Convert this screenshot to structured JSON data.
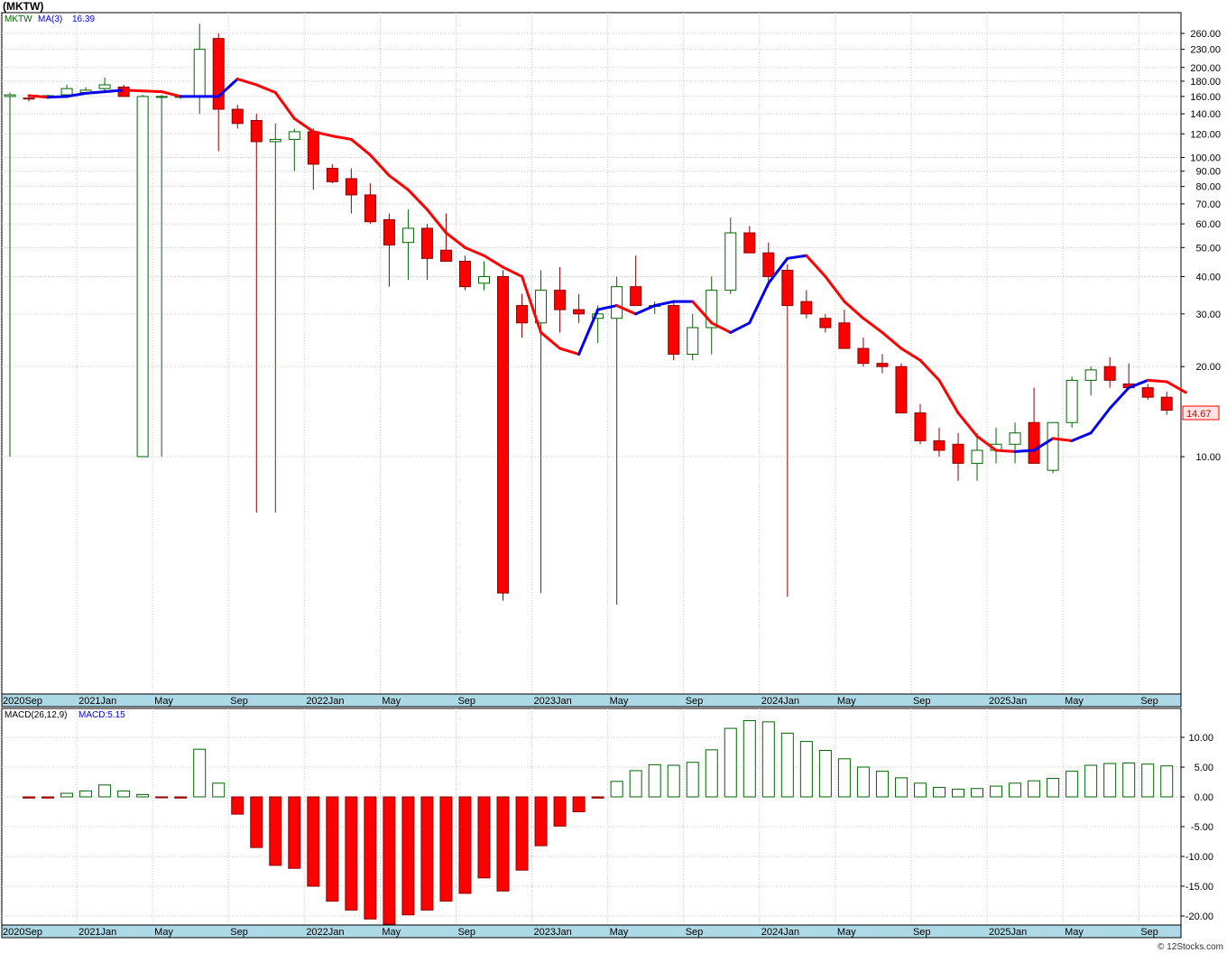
{
  "title": "(MKTW)",
  "footer": "© 12Stocks.com",
  "colors": {
    "up": "#006400",
    "down": "#ff0000",
    "ma_up": "#0000ee",
    "ma_down": "#ff0000",
    "macd_pos": "#006400",
    "macd_neg": "#ff0000",
    "axis_band": "#add8e6",
    "grid": "#c8c8c8"
  },
  "chart_data": [
    {
      "type": "candlestick",
      "scale": "log",
      "legend": {
        "ticker": "MKTW",
        "ma_label": "MA(3)",
        "ma_value": "16.39"
      },
      "last_price_label": "14.67",
      "y_ticks": [
        "260.00",
        "230.00",
        "200.00",
        "180.00",
        "160.00",
        "140.00",
        "120.00",
        "100.00",
        "90.00",
        "80.00",
        "70.00",
        "60.00",
        "50.00",
        "40.00",
        "30.00",
        "20.00",
        "10.00"
      ],
      "x_labels": [
        "2020Sep",
        "2021Jan",
        "May",
        "Sep",
        "2022Jan",
        "May",
        "Sep",
        "2023Jan",
        "May",
        "Sep",
        "2024Jan",
        "May",
        "Sep",
        "2025Jan",
        "May",
        "Sep"
      ],
      "grid": true,
      "candles": [
        {
          "o": 160,
          "h": 165,
          "l": 10,
          "c": 162
        },
        {
          "o": 158,
          "h": 160,
          "l": 154,
          "c": 157
        },
        {
          "o": 160,
          "h": 162,
          "l": 157,
          "c": 161
        },
        {
          "o": 162,
          "h": 175,
          "l": 158,
          "c": 170
        },
        {
          "o": 165,
          "h": 172,
          "l": 162,
          "c": 168
        },
        {
          "o": 170,
          "h": 185,
          "l": 165,
          "c": 175
        },
        {
          "o": 172,
          "h": 175,
          "l": 160,
          "c": 160
        },
        {
          "o": 10,
          "h": 162,
          "l": 10,
          "c": 160
        },
        {
          "o": 160,
          "h": 162,
          "l": 10,
          "c": 160
        },
        {
          "o": 160,
          "h": 162,
          "l": 157,
          "c": 160
        },
        {
          "o": 160,
          "h": 280,
          "l": 140,
          "c": 230
        },
        {
          "o": 250,
          "h": 260,
          "l": 105,
          "c": 145
        },
        {
          "o": 145,
          "h": 150,
          "l": 125,
          "c": 130
        },
        {
          "o": 133,
          "h": 140,
          "l": 6.5,
          "c": 113
        },
        {
          "o": 113,
          "h": 130,
          "l": 6.5,
          "c": 115
        },
        {
          "o": 115,
          "h": 125,
          "l": 90,
          "c": 122
        },
        {
          "o": 122,
          "h": 125,
          "l": 78,
          "c": 95
        },
        {
          "o": 92,
          "h": 95,
          "l": 82,
          "c": 83
        },
        {
          "o": 85,
          "h": 92,
          "l": 65,
          "c": 75
        },
        {
          "o": 75,
          "h": 82,
          "l": 60,
          "c": 61
        },
        {
          "o": 62,
          "h": 65,
          "l": 37,
          "c": 51
        },
        {
          "o": 52,
          "h": 67,
          "l": 39,
          "c": 58
        },
        {
          "o": 58,
          "h": 60,
          "l": 39,
          "c": 46
        },
        {
          "o": 49,
          "h": 65,
          "l": 45,
          "c": 45
        },
        {
          "o": 45,
          "h": 47,
          "l": 36,
          "c": 37
        },
        {
          "o": 38,
          "h": 45,
          "l": 36,
          "c": 40
        },
        {
          "o": 40,
          "h": 42,
          "l": 3.3,
          "c": 3.5
        },
        {
          "o": 32,
          "h": 35,
          "l": 25,
          "c": 28
        },
        {
          "o": 28,
          "h": 42,
          "l": 3.5,
          "c": 36
        },
        {
          "o": 36,
          "h": 43,
          "l": 26,
          "c": 31
        },
        {
          "o": 31,
          "h": 35,
          "l": 28,
          "c": 30
        },
        {
          "o": 29,
          "h": 32,
          "l": 24,
          "c": 30
        },
        {
          "o": 29,
          "h": 40,
          "l": 3.2,
          "c": 37
        },
        {
          "o": 37,
          "h": 47,
          "l": 32,
          "c": 32
        },
        {
          "o": 32,
          "h": 33,
          "l": 30,
          "c": 32
        },
        {
          "o": 32,
          "h": 33,
          "l": 21,
          "c": 22
        },
        {
          "o": 22,
          "h": 30,
          "l": 21,
          "c": 27
        },
        {
          "o": 27,
          "h": 40,
          "l": 22,
          "c": 36
        },
        {
          "o": 36,
          "h": 63,
          "l": 35,
          "c": 56
        },
        {
          "o": 56,
          "h": 59,
          "l": 50,
          "c": 48
        },
        {
          "o": 48,
          "h": 52,
          "l": 37,
          "c": 40
        },
        {
          "o": 42,
          "h": 44,
          "l": 3.4,
          "c": 32
        },
        {
          "o": 33,
          "h": 36,
          "l": 29,
          "c": 30
        },
        {
          "o": 29,
          "h": 30,
          "l": 26,
          "c": 27
        },
        {
          "o": 28,
          "h": 31,
          "l": 23,
          "c": 23
        },
        {
          "o": 23,
          "h": 25,
          "l": 20,
          "c": 20.5
        },
        {
          "o": 20.5,
          "h": 22,
          "l": 19,
          "c": 20
        },
        {
          "o": 20,
          "h": 20.5,
          "l": 14,
          "c": 14
        },
        {
          "o": 14,
          "h": 15,
          "l": 11,
          "c": 11.3
        },
        {
          "o": 11.3,
          "h": 12.5,
          "l": 10,
          "c": 10.5
        },
        {
          "o": 11,
          "h": 12,
          "l": 8.3,
          "c": 9.5
        },
        {
          "o": 9.5,
          "h": 12,
          "l": 8.3,
          "c": 10.5
        },
        {
          "o": 10.5,
          "h": 12.5,
          "l": 9.5,
          "c": 11
        },
        {
          "o": 11,
          "h": 13,
          "l": 9.5,
          "c": 12
        },
        {
          "o": 13,
          "h": 17,
          "l": 9.5,
          "c": 9.5
        },
        {
          "o": 9,
          "h": 13,
          "l": 8.8,
          "c": 13
        },
        {
          "o": 13,
          "h": 18.5,
          "l": 12.5,
          "c": 18
        },
        {
          "o": 18,
          "h": 20,
          "l": 16,
          "c": 19.5
        },
        {
          "o": 20,
          "h": 21.5,
          "l": 17,
          "c": 18
        },
        {
          "o": 17.5,
          "h": 20.5,
          "l": 17,
          "c": 17
        },
        {
          "o": 17,
          "h": 17.5,
          "l": 15.5,
          "c": 15.8
        },
        {
          "o": 15.8,
          "h": 16.5,
          "l": 13.8,
          "c": 14.3
        }
      ],
      "ma": [
        161,
        159,
        160,
        164,
        166,
        168,
        167,
        166,
        160,
        160,
        160,
        183,
        175,
        165,
        135,
        122,
        118,
        115,
        102,
        87,
        78,
        67,
        56,
        50,
        47,
        43,
        40,
        26,
        23,
        22,
        31,
        32,
        30,
        32,
        33,
        33,
        28,
        26,
        28,
        38,
        46,
        47,
        40,
        33,
        29,
        26,
        23,
        21,
        18,
        14,
        11.7,
        10.5,
        10.4,
        10.5,
        11.5,
        11.3,
        12,
        14.5,
        17,
        18,
        17.8,
        16.4
      ]
    },
    {
      "type": "bar",
      "legend": {
        "label": "MACD(26,12,9)",
        "value_label": "MACD:5.15"
      },
      "y_ticks": [
        "10.00",
        "5.00",
        "0.00",
        "-5.00",
        "-10.00",
        "-15.00",
        "-20.00"
      ],
      "ylim": [
        -21.5,
        13
      ],
      "x_labels": [
        "2020Sep",
        "2021Jan",
        "May",
        "Sep",
        "2022Jan",
        "May",
        "Sep",
        "2023Jan",
        "May",
        "Sep",
        "2024Jan",
        "May",
        "Sep",
        "2025Jan",
        "May",
        "Sep"
      ],
      "values": [
        -0.2,
        -0.2,
        0.6,
        1.0,
        2.0,
        1.0,
        0.4,
        -0.1,
        -0.2,
        8.0,
        2.3,
        -2.9,
        -8.5,
        -11.5,
        -12.0,
        -15.0,
        -17.5,
        -19.0,
        -20.5,
        -21.5,
        -19.8,
        -19.0,
        -17.5,
        -16.2,
        -13.6,
        -15.8,
        -12.3,
        -8.2,
        -4.9,
        -2.5,
        -0.2,
        2.6,
        4.4,
        5.4,
        5.3,
        5.8,
        7.9,
        11.5,
        12.8,
        12.6,
        10.7,
        9.3,
        7.8,
        6.4,
        5.0,
        4.3,
        3.2,
        2.3,
        1.6,
        1.3,
        1.4,
        1.8,
        2.3,
        2.7,
        3.1,
        4.3,
        5.3,
        5.6,
        5.7,
        5.5,
        5.2
      ]
    }
  ]
}
